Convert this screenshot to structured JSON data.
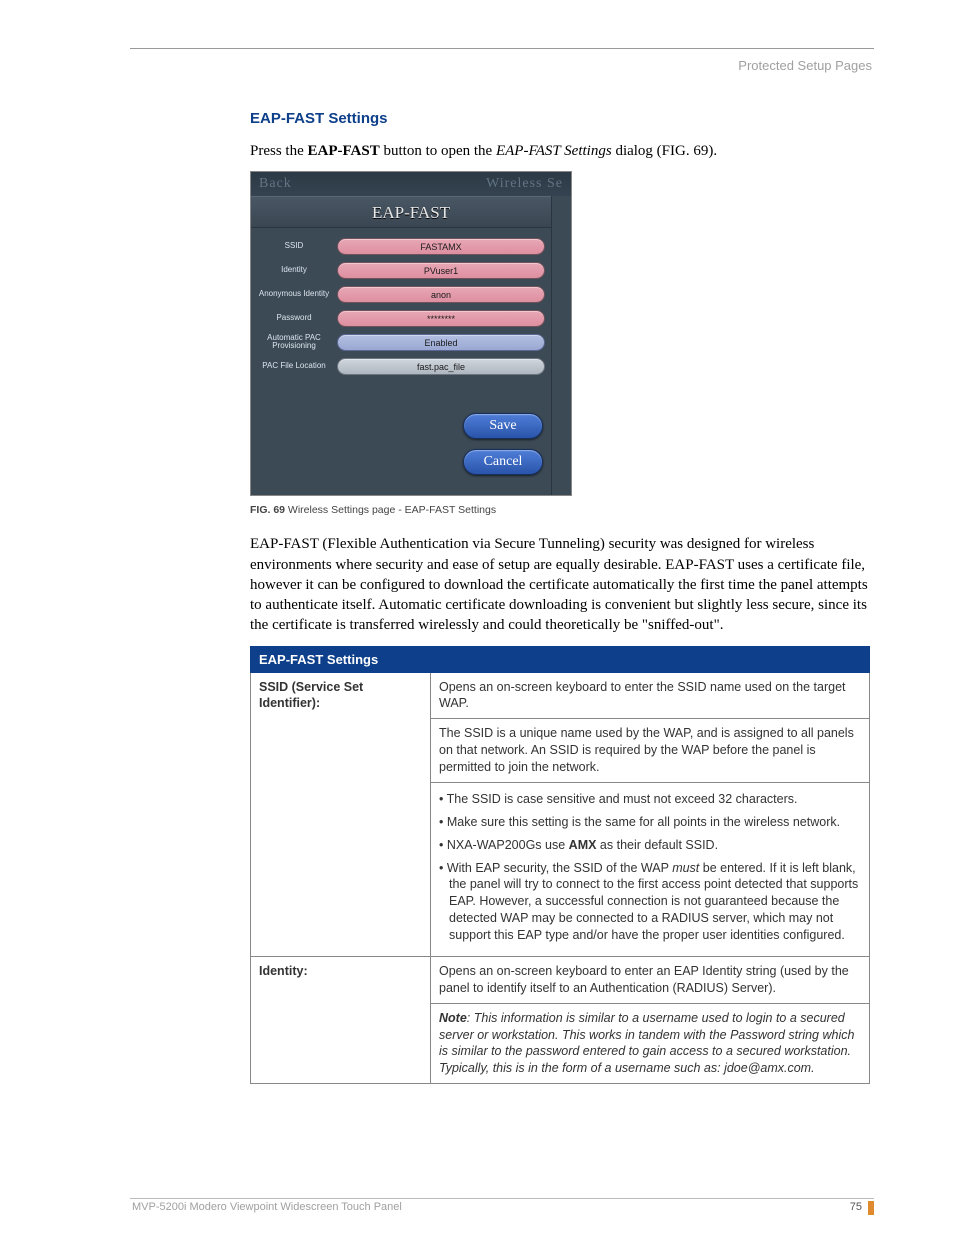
{
  "header": {
    "right": "Protected Setup Pages"
  },
  "section": {
    "title": "EAP-FAST Settings"
  },
  "intro": {
    "prefix": "Press the ",
    "bold": "EAP-FAST",
    "mid": " button to open the ",
    "italic": "EAP-FAST Settings",
    "suffix": " dialog (FIG. 69)."
  },
  "shot": {
    "back": "Back",
    "toptitle": "Wireless Se",
    "panel_title": "EAP-FAST",
    "rows": [
      {
        "label": "SSID",
        "value": "FASTAMX",
        "style": "pink"
      },
      {
        "label": "Identity",
        "value": "PVuser1",
        "style": "pink"
      },
      {
        "label": "Anonymous Identity",
        "value": "anon",
        "style": "pink"
      },
      {
        "label": "Password",
        "value": "********",
        "style": "pink"
      },
      {
        "label": "Automatic PAC Provisioning",
        "value": "Enabled",
        "style": "blue"
      },
      {
        "label": "PAC File Location",
        "value": "fast.pac_file",
        "style": "gray"
      }
    ],
    "save": "Save",
    "cancel": "Cancel"
  },
  "figcap": {
    "num": "FIG. 69",
    "text": "  Wireless Settings page - EAP-FAST Settings"
  },
  "para2": "EAP-FAST (Flexible Authentication via Secure Tunneling) security was designed for wireless environments where security and ease of setup are equally desirable. EAP-FAST uses a certificate file, however it can be configured to download the certificate automatically the first time the panel attempts to authenticate itself. Automatic certificate downloading is convenient but slightly less secure, since its the certificate is transferred wirelessly and could theoretically be \"sniffed-out\".",
  "table": {
    "header": "EAP-FAST Settings",
    "r1_label": "SSID (Service Set Identifier):",
    "r1_a": "Opens an on-screen keyboard to enter the SSID name used on the target WAP.",
    "r1_b": "The SSID is a unique name used by the WAP, and is assigned to all panels on that network. An SSID is required by the WAP before the panel is permitted to join the network.",
    "r1_bul1": "The SSID is case sensitive and must not exceed 32 characters.",
    "r1_bul2": "Make sure this setting is the same for all points in the wireless network.",
    "r1_bul3_a": "NXA-WAP200Gs use ",
    "r1_bul3_b": "AMX",
    "r1_bul3_c": " as their default SSID.",
    "r1_bul4_a": "With EAP security, the SSID of the WAP ",
    "r1_bul4_b": "must",
    "r1_bul4_c": " be entered. If it is left blank, the panel will try to connect to the first access point detected that supports EAP. However, a successful connection is not guaranteed because the detected WAP may be connected to a RADIUS server, which may not support this EAP type and/or have the proper user identities configured.",
    "r2_label": "Identity:",
    "r2_a": "Opens an on-screen keyboard to enter an EAP Identity string (used by the panel to identify itself to an Authentication (RADIUS) Server).",
    "r2_note_b": "Note",
    "r2_note": ": This information is similar to a username used to login to a secured server or workstation. This works in tandem with the Password string which is similar to the password entered to gain access to a secured workstation. Typically, this is in the form of a username such as: jdoe@amx.com."
  },
  "footer": {
    "left": "MVP-5200i Modero Viewpoint Widescreen Touch Panel",
    "page": "75"
  }
}
